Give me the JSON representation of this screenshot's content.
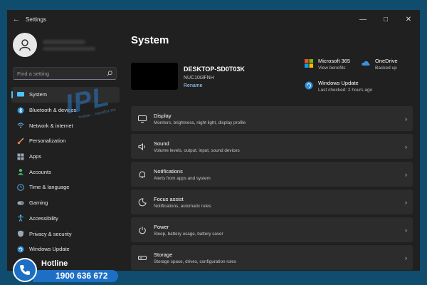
{
  "window": {
    "title": "Settings",
    "back": "←",
    "minimize": "—",
    "maximize": "□",
    "close": "✕"
  },
  "search": {
    "placeholder": "Find a setting"
  },
  "sidebar": {
    "items": [
      {
        "label": "System",
        "icon": "monitor-icon",
        "active": true
      },
      {
        "label": "Bluetooth & devices",
        "icon": "bluetooth-icon"
      },
      {
        "label": "Network & internet",
        "icon": "wifi-icon"
      },
      {
        "label": "Personalization",
        "icon": "brush-icon"
      },
      {
        "label": "Apps",
        "icon": "apps-icon"
      },
      {
        "label": "Accounts",
        "icon": "person-icon"
      },
      {
        "label": "Time & language",
        "icon": "globe-clock-icon"
      },
      {
        "label": "Gaming",
        "icon": "gamepad-icon"
      },
      {
        "label": "Accessibility",
        "icon": "accessibility-icon"
      },
      {
        "label": "Privacy & security",
        "icon": "shield-icon"
      },
      {
        "label": "Windows Update",
        "icon": "update-icon"
      }
    ]
  },
  "main": {
    "title": "System",
    "device": {
      "name": "DESKTOP-SD0T03K",
      "model": "NUC10i3FNH",
      "rename": "Rename"
    },
    "quick_status": {
      "m365": {
        "title": "Microsoft 365",
        "sub": "View benefits"
      },
      "onedrive": {
        "title": "OneDrive",
        "sub": "Backed up"
      },
      "update": {
        "title": "Windows Update",
        "sub": "Last checked: 2 hours ago"
      }
    },
    "cards": [
      {
        "title": "Display",
        "sub": "Monitors, brightness, night light, display profile",
        "icon": "display-icon"
      },
      {
        "title": "Sound",
        "sub": "Volume levels, output, input, sound devices",
        "icon": "speaker-icon"
      },
      {
        "title": "Notifications",
        "sub": "Alerts from apps and system",
        "icon": "bell-icon"
      },
      {
        "title": "Focus assist",
        "sub": "Notifications, automatic rules",
        "icon": "moon-icon"
      },
      {
        "title": "Power",
        "sub": "Sleep, battery usage, battery saver",
        "icon": "power-icon"
      },
      {
        "title": "Storage",
        "sub": "Storage space, drives, configuration rules",
        "icon": "storage-icon"
      }
    ]
  },
  "watermark": {
    "text": "IPL",
    "sub": "THÀNH ... NGHIỆM TRÍ"
  },
  "hotline": {
    "label": "Hotline",
    "number": "1900 636 672"
  },
  "colors": {
    "accent": "#4cc2ff",
    "window_bg": "#202020",
    "card_bg": "#2c2c2c",
    "desktop": "#0f4c6e",
    "hotline_blue": "#1d6fc4"
  }
}
